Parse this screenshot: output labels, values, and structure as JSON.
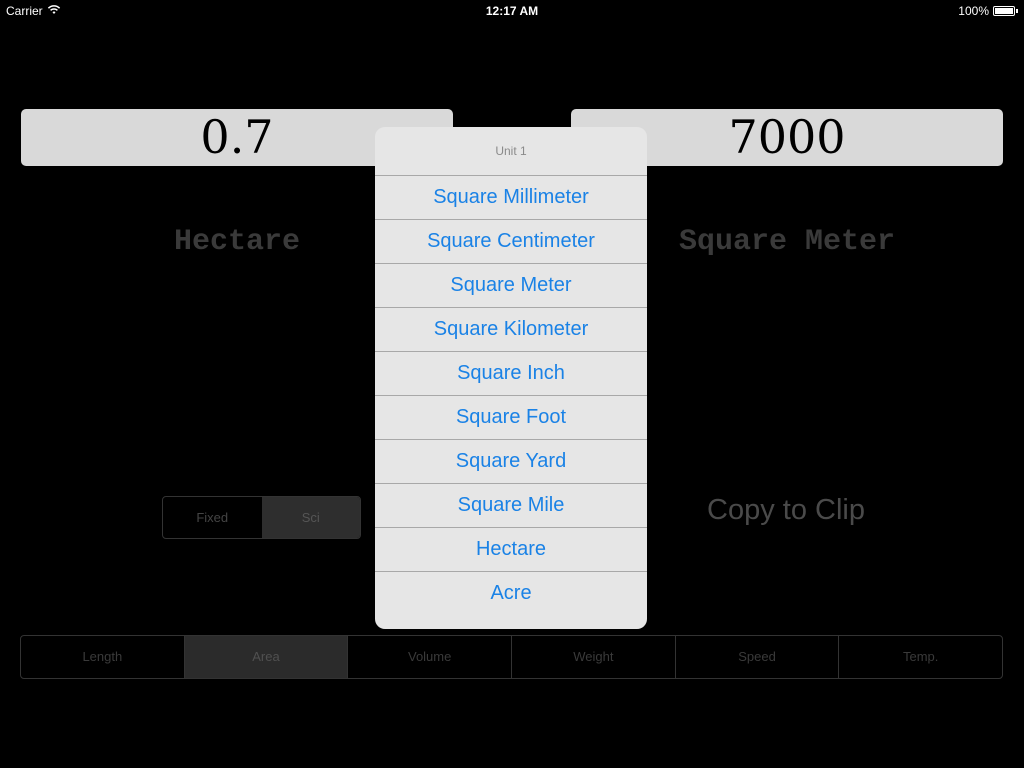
{
  "status_bar": {
    "carrier": "Carrier",
    "time": "12:17 AM",
    "battery": "100%",
    "battery_level": 1.0
  },
  "converter": {
    "left_value": "0.7",
    "right_value": "7000",
    "left_unit": "Hectare",
    "right_unit": "Square Meter"
  },
  "format": {
    "fixed_label": "Fixed",
    "sci_label": "Sci",
    "selected": "Sci"
  },
  "copy_label": "Copy to Clip",
  "categories": {
    "selected": "Area",
    "items": [
      {
        "label": "Length"
      },
      {
        "label": "Area"
      },
      {
        "label": "Volume"
      },
      {
        "label": "Weight"
      },
      {
        "label": "Speed"
      },
      {
        "label": "Temp."
      }
    ]
  },
  "popover": {
    "title": "Unit 1",
    "items": [
      {
        "label": "Square Millimeter"
      },
      {
        "label": "Square Centimeter"
      },
      {
        "label": "Square Meter"
      },
      {
        "label": "Square Kilometer"
      },
      {
        "label": "Square Inch"
      },
      {
        "label": "Square Foot"
      },
      {
        "label": "Square Yard"
      },
      {
        "label": "Square Mile"
      },
      {
        "label": "Hectare"
      },
      {
        "label": "Acre"
      }
    ]
  },
  "colors": {
    "accent": "#1a82e6",
    "background": "#000000",
    "field": "#d9d9d9"
  }
}
